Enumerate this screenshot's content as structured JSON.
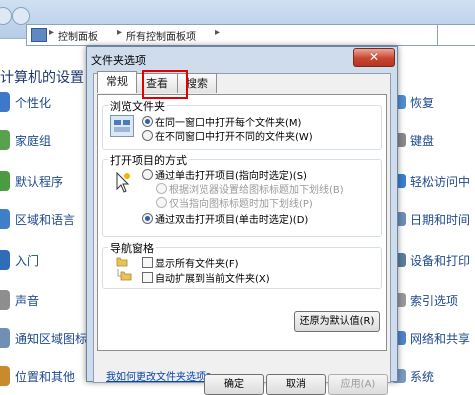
{
  "breadcrumb": [
    "控制面板",
    "所有控制面板项"
  ],
  "panel": {
    "title": "计算机的设置",
    "left_items": [
      "个性化",
      "家庭组",
      "默认程序",
      "区域和语言",
      "入门",
      "声音",
      "通知区域图标",
      "位置和其他"
    ],
    "right_items": [
      "恢复",
      "键盘",
      "轻松访问中",
      "日期和时间",
      "设备和打印",
      "索引选项",
      "网络和共享",
      "系统"
    ]
  },
  "dialog": {
    "title": "文件夹选项",
    "close_label": "✕",
    "tabs": [
      "常规",
      "查看",
      "搜索"
    ],
    "browse": {
      "label": "浏览文件夹",
      "opt1": "在同一窗口中打开每个文件夹(M)",
      "opt2": "在不同窗口中打开不同的文件夹(W)"
    },
    "click": {
      "label": "打开项目的方式",
      "opt1": "通过单击打开项目(指向时选定)(S)",
      "sub1": "根据浏览器设置给图标标题加下划线(B)",
      "sub2": "仅当指向图标标题时加下划线(P)",
      "opt2": "通过双击打开项目(单击时选定)(D)"
    },
    "nav": {
      "label": "导航窗格",
      "chk1": "显示所有文件夹(F)",
      "chk2": "自动扩展到当前文件夹(X)"
    },
    "restore_label": "还原为默认值(R)",
    "help_link": "我如何更改文件夹选项?",
    "ok_label": "确定",
    "cancel_label": "取消",
    "apply_label": "应用(A)"
  }
}
